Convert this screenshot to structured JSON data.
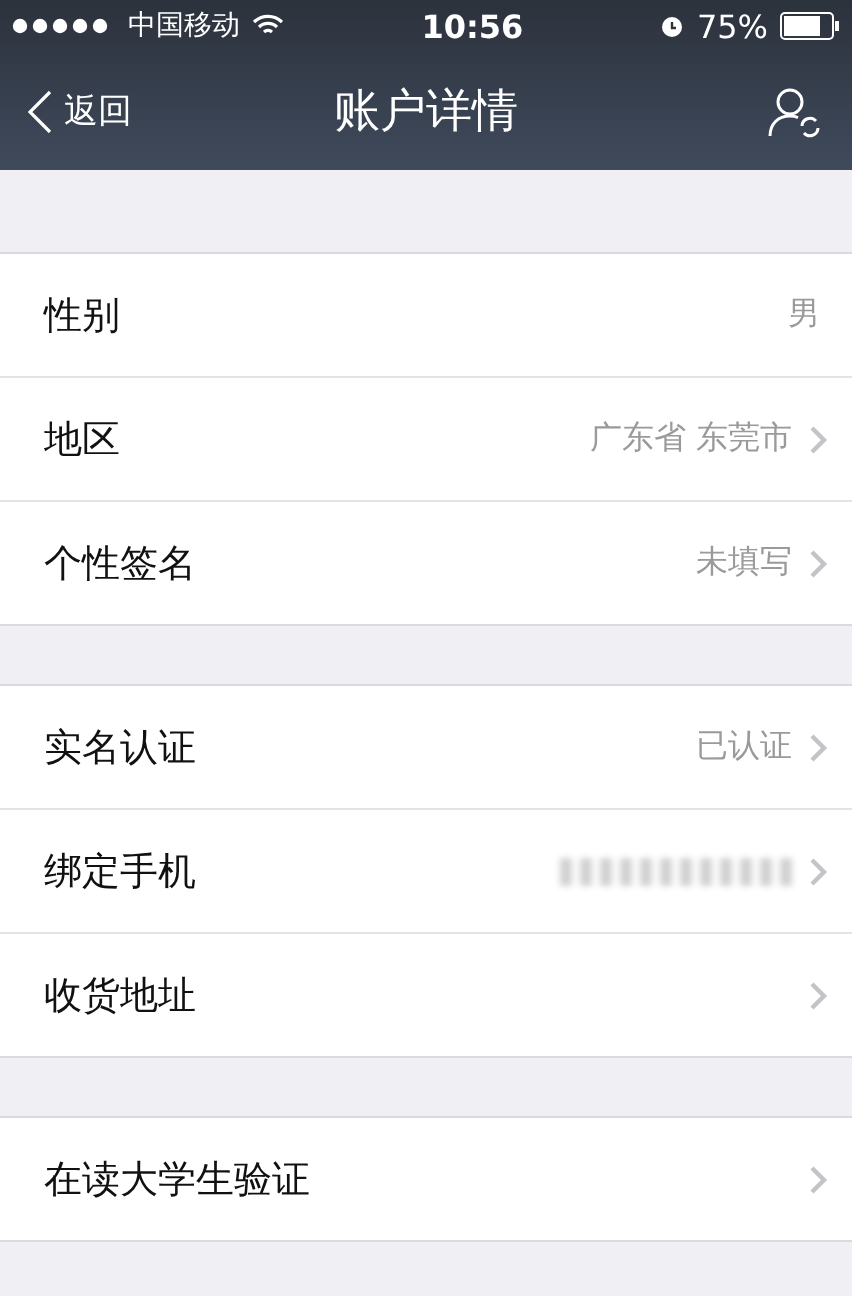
{
  "status_bar": {
    "carrier": "中国移动",
    "time": "10:56",
    "battery": "75%"
  },
  "nav": {
    "back": "返回",
    "title": "账户详情"
  },
  "groups": [
    {
      "rows": [
        {
          "kind": "text",
          "label": "性别",
          "value": "男",
          "chevron": false
        },
        {
          "kind": "text",
          "label": "地区",
          "value": "广东省 东莞市",
          "chevron": true
        },
        {
          "kind": "text",
          "label": "个性签名",
          "value": "未填写",
          "chevron": true
        }
      ]
    },
    {
      "rows": [
        {
          "kind": "text",
          "label": "实名认证",
          "value": "已认证",
          "chevron": true
        },
        {
          "kind": "redacted",
          "label": "绑定手机",
          "chevron": true
        },
        {
          "kind": "text",
          "label": "收货地址",
          "chevron": true
        }
      ]
    },
    {
      "rows": [
        {
          "kind": "text",
          "label": "在读大学生验证",
          "chevron": true
        }
      ]
    }
  ]
}
